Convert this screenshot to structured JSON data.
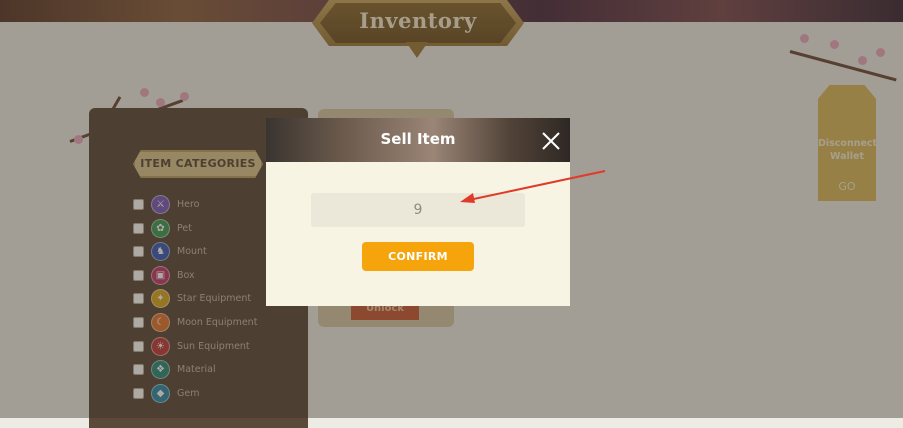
{
  "header": {
    "title": "Inventory"
  },
  "sidebar": {
    "header_label": "ITEM CATEGORIES",
    "items": [
      {
        "label": "Hero",
        "icon": "hero-icon",
        "color": "#7b5bb8"
      },
      {
        "label": "Pet",
        "icon": "pet-icon",
        "color": "#3d9a55"
      },
      {
        "label": "Mount",
        "icon": "mount-icon",
        "color": "#3a5ab8"
      },
      {
        "label": "Box",
        "icon": "box-icon",
        "color": "#c03a6a"
      },
      {
        "label": "Star Equipment",
        "icon": "star-icon",
        "color": "#d8a820"
      },
      {
        "label": "Moon Equipment",
        "icon": "moon-icon",
        "color": "#e0742c"
      },
      {
        "label": "Sun Equipment",
        "icon": "sun-icon",
        "color": "#c03a3a"
      },
      {
        "label": "Material",
        "icon": "material-icon",
        "color": "#2a8a7a"
      },
      {
        "label": "Gem",
        "icon": "gem-icon",
        "color": "#2a8aa8"
      }
    ]
  },
  "card": {
    "unlock_label": "Unlock"
  },
  "wallet": {
    "label_line1": "Disconnect",
    "label_line2": "Wallet",
    "go": "GO"
  },
  "modal": {
    "title": "Sell Item",
    "quantity_value": "9",
    "confirm_label": "CONFIRM"
  },
  "colors": {
    "accent": "#f5a40b",
    "panel": "#5b4a3a",
    "modal_bg": "#f8f4e4",
    "annotation": "#e03a2a"
  }
}
